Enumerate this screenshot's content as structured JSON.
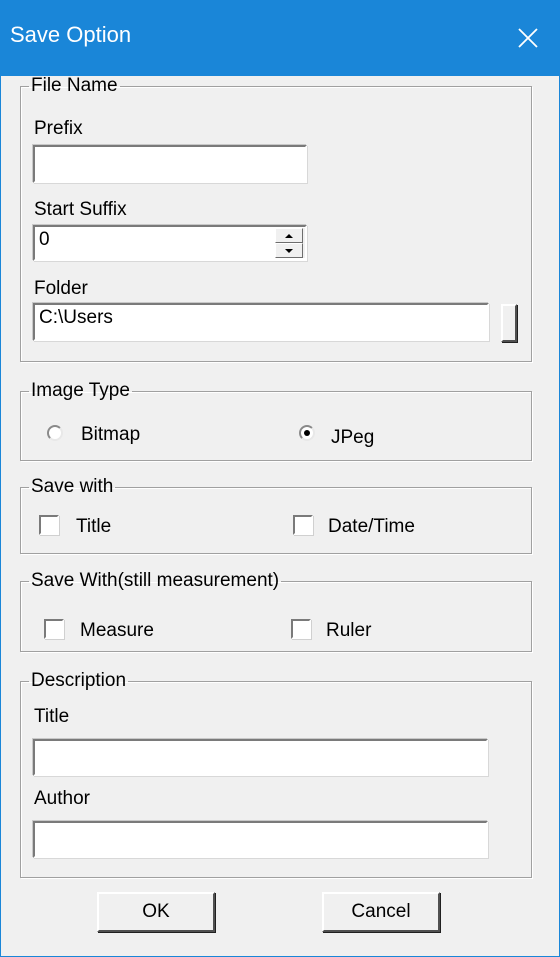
{
  "window": {
    "title": "Save Option",
    "close_icon": "close-icon"
  },
  "file_name": {
    "legend": "File Name",
    "prefix_label": "Prefix",
    "prefix_value": "",
    "start_suffix_label": "Start Suffix",
    "start_suffix_value": "0",
    "folder_label": "Folder",
    "folder_value": "C:\\Users"
  },
  "image_type": {
    "legend": "Image Type",
    "options": [
      {
        "label": "Bitmap",
        "selected": false
      },
      {
        "label": "JPeg",
        "selected": true
      }
    ]
  },
  "save_with": {
    "legend": "Save with",
    "options": [
      {
        "label": "Title",
        "checked": false
      },
      {
        "label": "Date/Time",
        "checked": false
      }
    ]
  },
  "save_with_still": {
    "legend": "Save With(still measurement)",
    "options": [
      {
        "label": "Measure",
        "checked": false
      },
      {
        "label": "Ruler",
        "checked": false
      }
    ]
  },
  "description": {
    "legend": "Description",
    "title_label": "Title",
    "title_value": "",
    "author_label": "Author",
    "author_value": ""
  },
  "buttons": {
    "ok": "OK",
    "cancel": "Cancel"
  },
  "colors": {
    "title_bar": "#1a86d8",
    "dialog_bg": "#f0f0f0"
  }
}
